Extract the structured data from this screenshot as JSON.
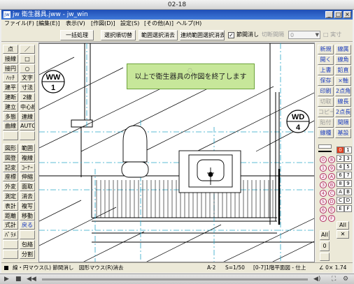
{
  "player": {
    "title": "02-18"
  },
  "window": {
    "title": "jw 衛生器具.jww - jw_win",
    "minimize": "_",
    "maximize": "□",
    "close": "×"
  },
  "menu": [
    "ファイル(F)",
    "[編集(E)]",
    "表示(V)",
    "[作図(D)]",
    "設定(S)",
    "[その他(A)]",
    "ヘルプ(H)"
  ],
  "toolbar": {
    "buttons": [
      "一括処理",
      "選択順切替",
      "範囲選択消去",
      "連続範囲選択消去"
    ],
    "checkbox_label": "節間消し",
    "dropdown_label": "切断間隔",
    "dropdown_value": "0",
    "tail_label": "□ 実寸"
  },
  "left_tools": [
    {
      "a": "点",
      "b": "／"
    },
    {
      "a": "接線",
      "b": "□"
    },
    {
      "a": "接円",
      "b": "○"
    },
    {
      "a": "ﾊｯﾁ",
      "b": "文字"
    },
    {
      "a": "建平",
      "b": "寸法"
    },
    {
      "a": "建断",
      "b": "2線"
    },
    {
      "a": "建立",
      "b": "中心線"
    },
    {
      "a": "多態",
      "b": "連線"
    },
    {
      "a": "曲線",
      "b": "AUTO"
    },
    {
      "a": "",
      "b": ""
    },
    {
      "a": "図形",
      "b": "範囲"
    },
    {
      "a": "図登",
      "b": "複線"
    },
    {
      "a": "記変",
      "b": "ｺｰﾅｰ"
    },
    {
      "a": "座標",
      "b": "伸縮"
    },
    {
      "a": "外変",
      "b": "面取"
    },
    {
      "a": "測定",
      "b": "消去"
    },
    {
      "a": "表計",
      "b": "複写"
    },
    {
      "a": "距離",
      "b": "移動"
    },
    {
      "a": "式計",
      "b": "戻る"
    },
    {
      "a": "ﾊﾟﾗﾒ",
      "b": ""
    },
    {
      "a": "",
      "b": "包絡"
    },
    {
      "a": "",
      "b": "分割"
    }
  ],
  "right_tools": [
    {
      "a": "新規",
      "b": "線属"
    },
    {
      "a": "開く",
      "b": "線角"
    },
    {
      "a": "上書",
      "b": "鉛直"
    },
    {
      "a": "保存",
      "b": "×軸"
    },
    {
      "a": "印刷",
      "b": "2点角"
    },
    {
      "a": "切取",
      "b": "線長"
    },
    {
      "a": "コピー",
      "b": "2点長"
    },
    {
      "a": "貼付",
      "b": "間隔"
    },
    {
      "a": "線種",
      "b": "基設"
    }
  ],
  "tooltip": {
    "message": "以上で衛生器具の作図を終了します"
  },
  "drawing": {
    "label_ww": "WW",
    "label_ww_num": "1",
    "label_wd": "WD",
    "label_wd_num": "4"
  },
  "layer_panel": {
    "group_nums": [
      "0",
      "1",
      "2",
      "3",
      "4",
      "5",
      "6",
      "7",
      "8",
      "9",
      "A",
      "B",
      "C",
      "D",
      "E",
      "F"
    ],
    "all_label": "All",
    "zero_label": "0",
    "x_label": "✕"
  },
  "status": {
    "left_hint": "線・円マウス(L) 節間消し　図形マウス(R)消去",
    "paper": "A-2",
    "scale": "S=1/50",
    "layer": "[0-7]1階平面図 - 仕上",
    "zoom": "∠ 0",
    "factor": "× 1.74"
  },
  "colors": {
    "title_bar": "#2a5bc4",
    "tooltip_bg": "#c7e79a",
    "drawing_line": "#000000",
    "center_line": "#2aa6c8",
    "selected_layer": "#e04020"
  }
}
